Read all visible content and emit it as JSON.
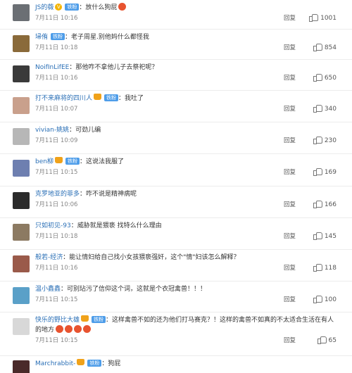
{
  "badge_label": "铁粉",
  "reply_label": "回复",
  "comments": [
    {
      "user": "JS的薇",
      "text": "：放什么狗屁",
      "time": "7月11日 10:16",
      "likes": "1001",
      "avatar_color": "#6b6f74",
      "vip": true
    },
    {
      "user": "埽侑",
      "text": "：老子周星.别他妈什么都怪我",
      "time": "7月11日 10:18",
      "likes": "854",
      "avatar_color": "#8a6a3a"
    },
    {
      "user": "NoifInLifEE",
      "text": "：那他咋不拿他儿子去祭祀呢？",
      "time": "7月11日 10:16",
      "likes": "650",
      "avatar_color": "#3a3a3a"
    },
    {
      "user": "打不来麻将的四川人",
      "text": "：我吐了",
      "time": "7月11日 10:07",
      "likes": "340",
      "avatar_color": "#c9a08c",
      "crown": true
    },
    {
      "user": "vivian-姚姚",
      "text": "：可劲儿编",
      "time": "7月11日 10:09",
      "likes": "230",
      "avatar_color": "#b7b7b7"
    },
    {
      "user": "ben柳",
      "text": "：这说法我服了",
      "time": "7月11日 10:15",
      "likes": "169",
      "avatar_color": "#6e7fb0",
      "crown": true
    },
    {
      "user": "克罗地亚的菲多",
      "text": "：咋不说是精神病呢",
      "time": "7月11日 10:06",
      "likes": "166",
      "avatar_color": "#2b2b2b"
    },
    {
      "user": "只如初见-93",
      "text": "：威胁就是猥亵 找特么什么理由",
      "time": "7月11日 10:18",
      "likes": "145",
      "avatar_color": "#8c7a62"
    },
    {
      "user": "般若-经济",
      "text": "：能让情妇给自己找小女孩猥亵强奸，这个\"情\"妇该怎么解释？",
      "time": "7月11日 10:16",
      "likes": "118",
      "avatar_color": "#9a5a4a"
    },
    {
      "user": "温小鑫鑫",
      "text": "：可别玷污了信仰这个词，这就是个衣冠禽兽！！！",
      "time": "7月11日 10:15",
      "likes": "100",
      "avatar_color": "#5aa0c8"
    },
    {
      "user": "快乐的野比大雄",
      "text": "：这样禽兽不如的还为他们打马赛克？！这样的禽兽不如真的不太适合生活在有人的地方",
      "time": "7月11日 10:15",
      "likes": "65",
      "avatar_color": "#d8d8d8",
      "crown": true,
      "emojis": 4
    },
    {
      "user": "Marchrabbit-",
      "text": "：狗屁",
      "time": "",
      "likes": "",
      "avatar_color": "#4a2a2a",
      "crown": true
    }
  ]
}
